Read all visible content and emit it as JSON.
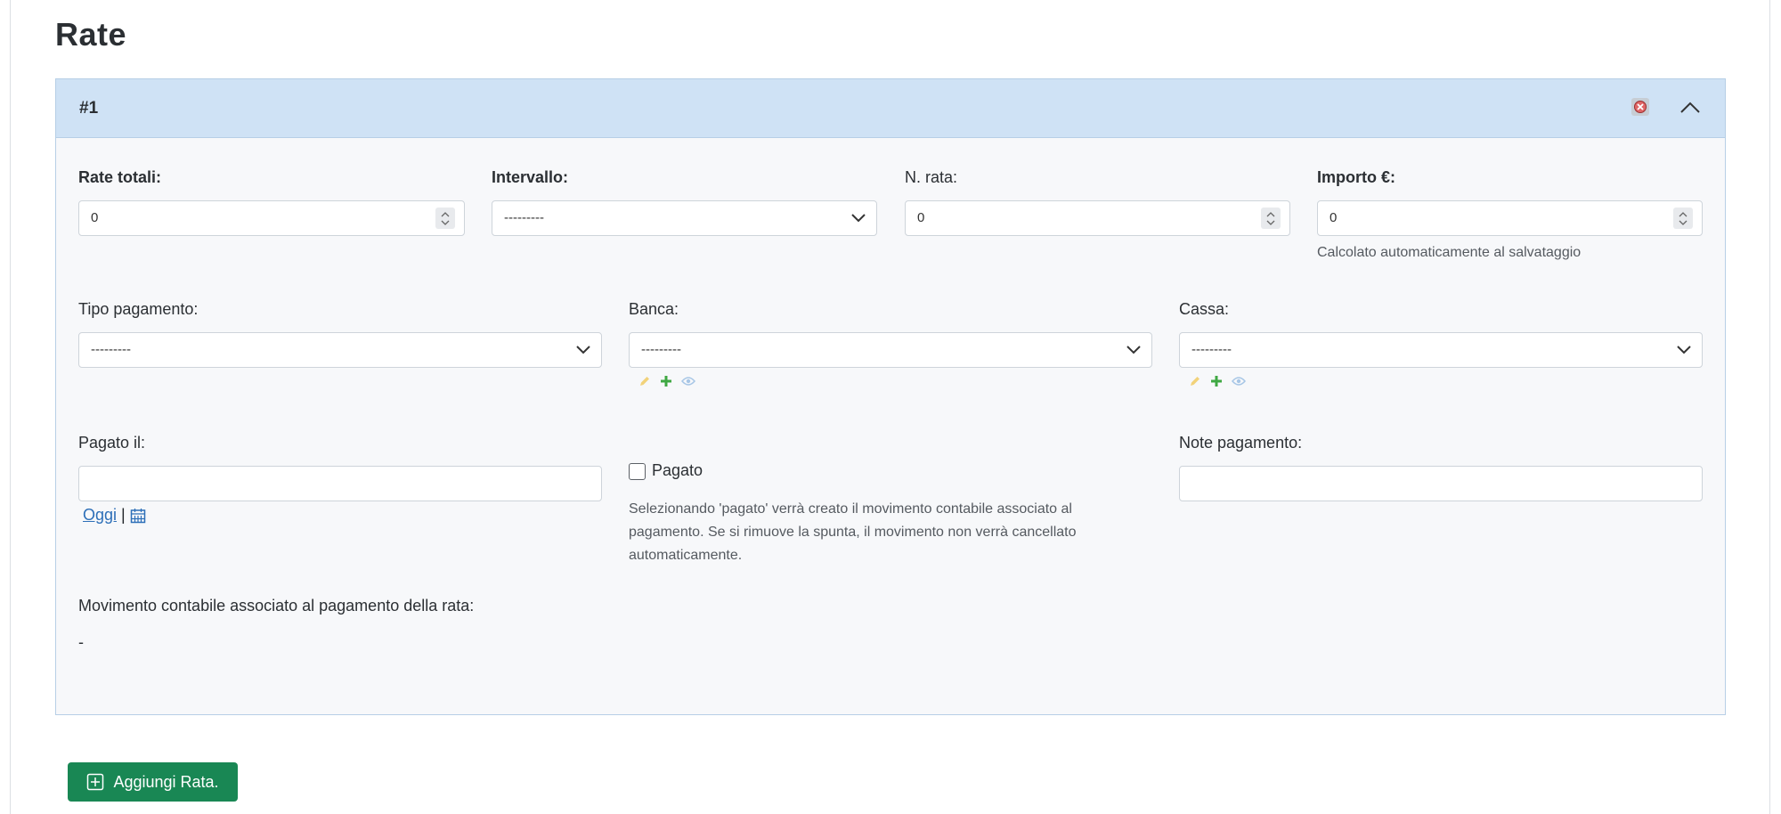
{
  "page": {
    "title": "Rate"
  },
  "installment": {
    "header_title": "#1",
    "fields": {
      "rate_totali": {
        "label": "Rate totali:",
        "value": "0"
      },
      "intervallo": {
        "label": "Intervallo:",
        "value": "---------"
      },
      "n_rata": {
        "label": "N. rata:",
        "value": "0"
      },
      "importo": {
        "label": "Importo €:",
        "value": "0",
        "help": "Calcolato automaticamente al salvataggio"
      },
      "tipo_pagamento": {
        "label": "Tipo pagamento:",
        "value": "---------"
      },
      "banca": {
        "label": "Banca:",
        "value": "---------"
      },
      "cassa": {
        "label": "Cassa:",
        "value": "---------"
      },
      "pagato_il": {
        "label": "Pagato il:",
        "value": "",
        "today_link": "Oggi",
        "separator": "|"
      },
      "pagato": {
        "label": "Pagato",
        "checked": false,
        "help": "Selezionando 'pagato' verrà creato il movimento contabile associato al pagamento. Se si rimuove la spunta, il movimento non verrà cancellato automaticamente."
      },
      "note_pagamento": {
        "label": "Note pagamento:",
        "value": ""
      }
    },
    "movement": {
      "label": "Movimento contabile associato al pagamento della rata:",
      "value": "-"
    },
    "icons": {
      "edit": "pencil-icon",
      "add": "plus-icon",
      "view": "eye-icon",
      "delete": "delete-icon",
      "collapse": "chevron-up-icon",
      "calendar": "calendar-icon"
    }
  },
  "actions": {
    "add_label": "Aggiungi Rata."
  },
  "colors": {
    "header_bg": "#cfe2f5",
    "card_bg": "#f7f8fa",
    "add_button": "#198754",
    "link": "#2d6fb8",
    "edit_icon": "#f2d27a",
    "add_icon": "#3fa843",
    "view_icon": "#a7c6e6"
  }
}
